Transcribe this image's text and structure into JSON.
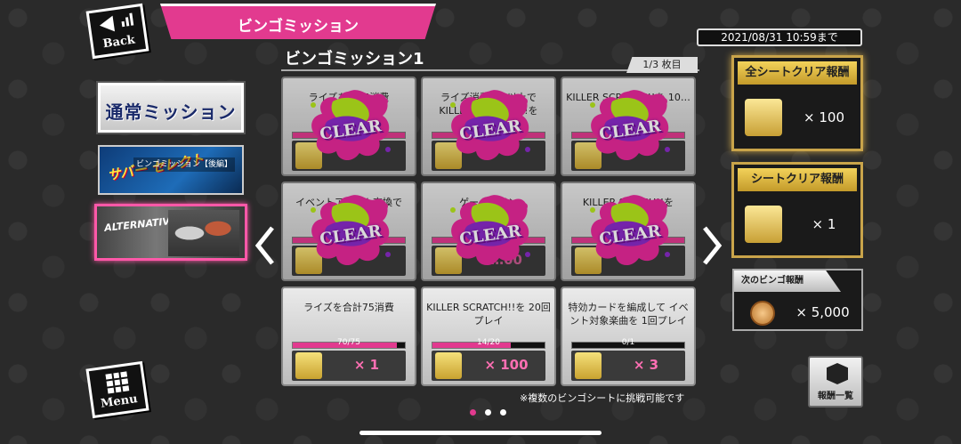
{
  "header": {
    "back_label": "Back",
    "title": "ビンゴミッション",
    "deadline": "2021/08/31 10:59まで"
  },
  "nav": {
    "normal_mission": "通常ミッション",
    "bingo_kohen_logo": "サバー セレクト",
    "bingo_kohen_sub": "ビンゴミッション【後編】",
    "alternative_logo": "ALTERNATIVE STREET",
    "menu_label": "Menu"
  },
  "sheet": {
    "title": "ビンゴミッション1",
    "page_counter": "1/3 枚目",
    "note": "※複数のビンゴシートに挑戦可能です",
    "clear_stamp": "CLEAR"
  },
  "cells": [
    {
      "title": "ライズを…75消費",
      "progress": "",
      "reward_icon": "ticket-icon",
      "qty": "",
      "cleared": true
    },
    {
      "title": "ライズ消費×…以上で KILLER SCRATCH!!を",
      "progress": "",
      "reward_icon": "card-icon",
      "qty": "",
      "cleared": true
    },
    {
      "title": "KILLER SCRATCH!!を 10…",
      "progress": "",
      "reward_icon": "ticket-icon",
      "qty": "",
      "cleared": true
    },
    {
      "title": "イベントアイテム交換で",
      "progress": "",
      "reward_icon": "bottle-icon",
      "qty": "",
      "cleared": true
    },
    {
      "title": "ゲーム…イン",
      "progress": "",
      "reward_icon": "ep-coin-icon",
      "qty": "…00",
      "cleared": true
    },
    {
      "title": "KILLER SC…CH!!を",
      "progress": "",
      "reward_icon": "card-icon",
      "qty": "",
      "cleared": true
    },
    {
      "title": "ライズを合計75消費",
      "progress": "70/75",
      "progress_fraction": 0.93,
      "reward_icon": "bottle-icon",
      "qty": "× 1",
      "cleared": false
    },
    {
      "title": "KILLER SCRATCH!!を 20回プレイ",
      "progress": "14/20",
      "progress_fraction": 0.7,
      "reward_icon": "triangle-ticket-icon",
      "qty": "× 100",
      "cleared": false
    },
    {
      "title": "特効カードを編成して イベント対象楽曲を 1回プレイ",
      "progress": "0/1",
      "progress_fraction": 0,
      "reward_icon": "cassette-icon",
      "qty": "× 3",
      "cleared": false
    }
  ],
  "rewards": {
    "all_sheet_title": "全シートクリア報酬",
    "all_sheet_qty": "× 100",
    "sheet_title": "シートクリア報酬",
    "sheet_qty": "× 1",
    "next_title": "次のビンゴ報酬",
    "next_qty": "× 5,000",
    "list_button": "報酬一覧"
  },
  "pagination": {
    "total": 3,
    "active": 1
  },
  "colors": {
    "accent": "#e23a8f",
    "gold": "#c9a44a",
    "background": "#2a2a2a"
  }
}
